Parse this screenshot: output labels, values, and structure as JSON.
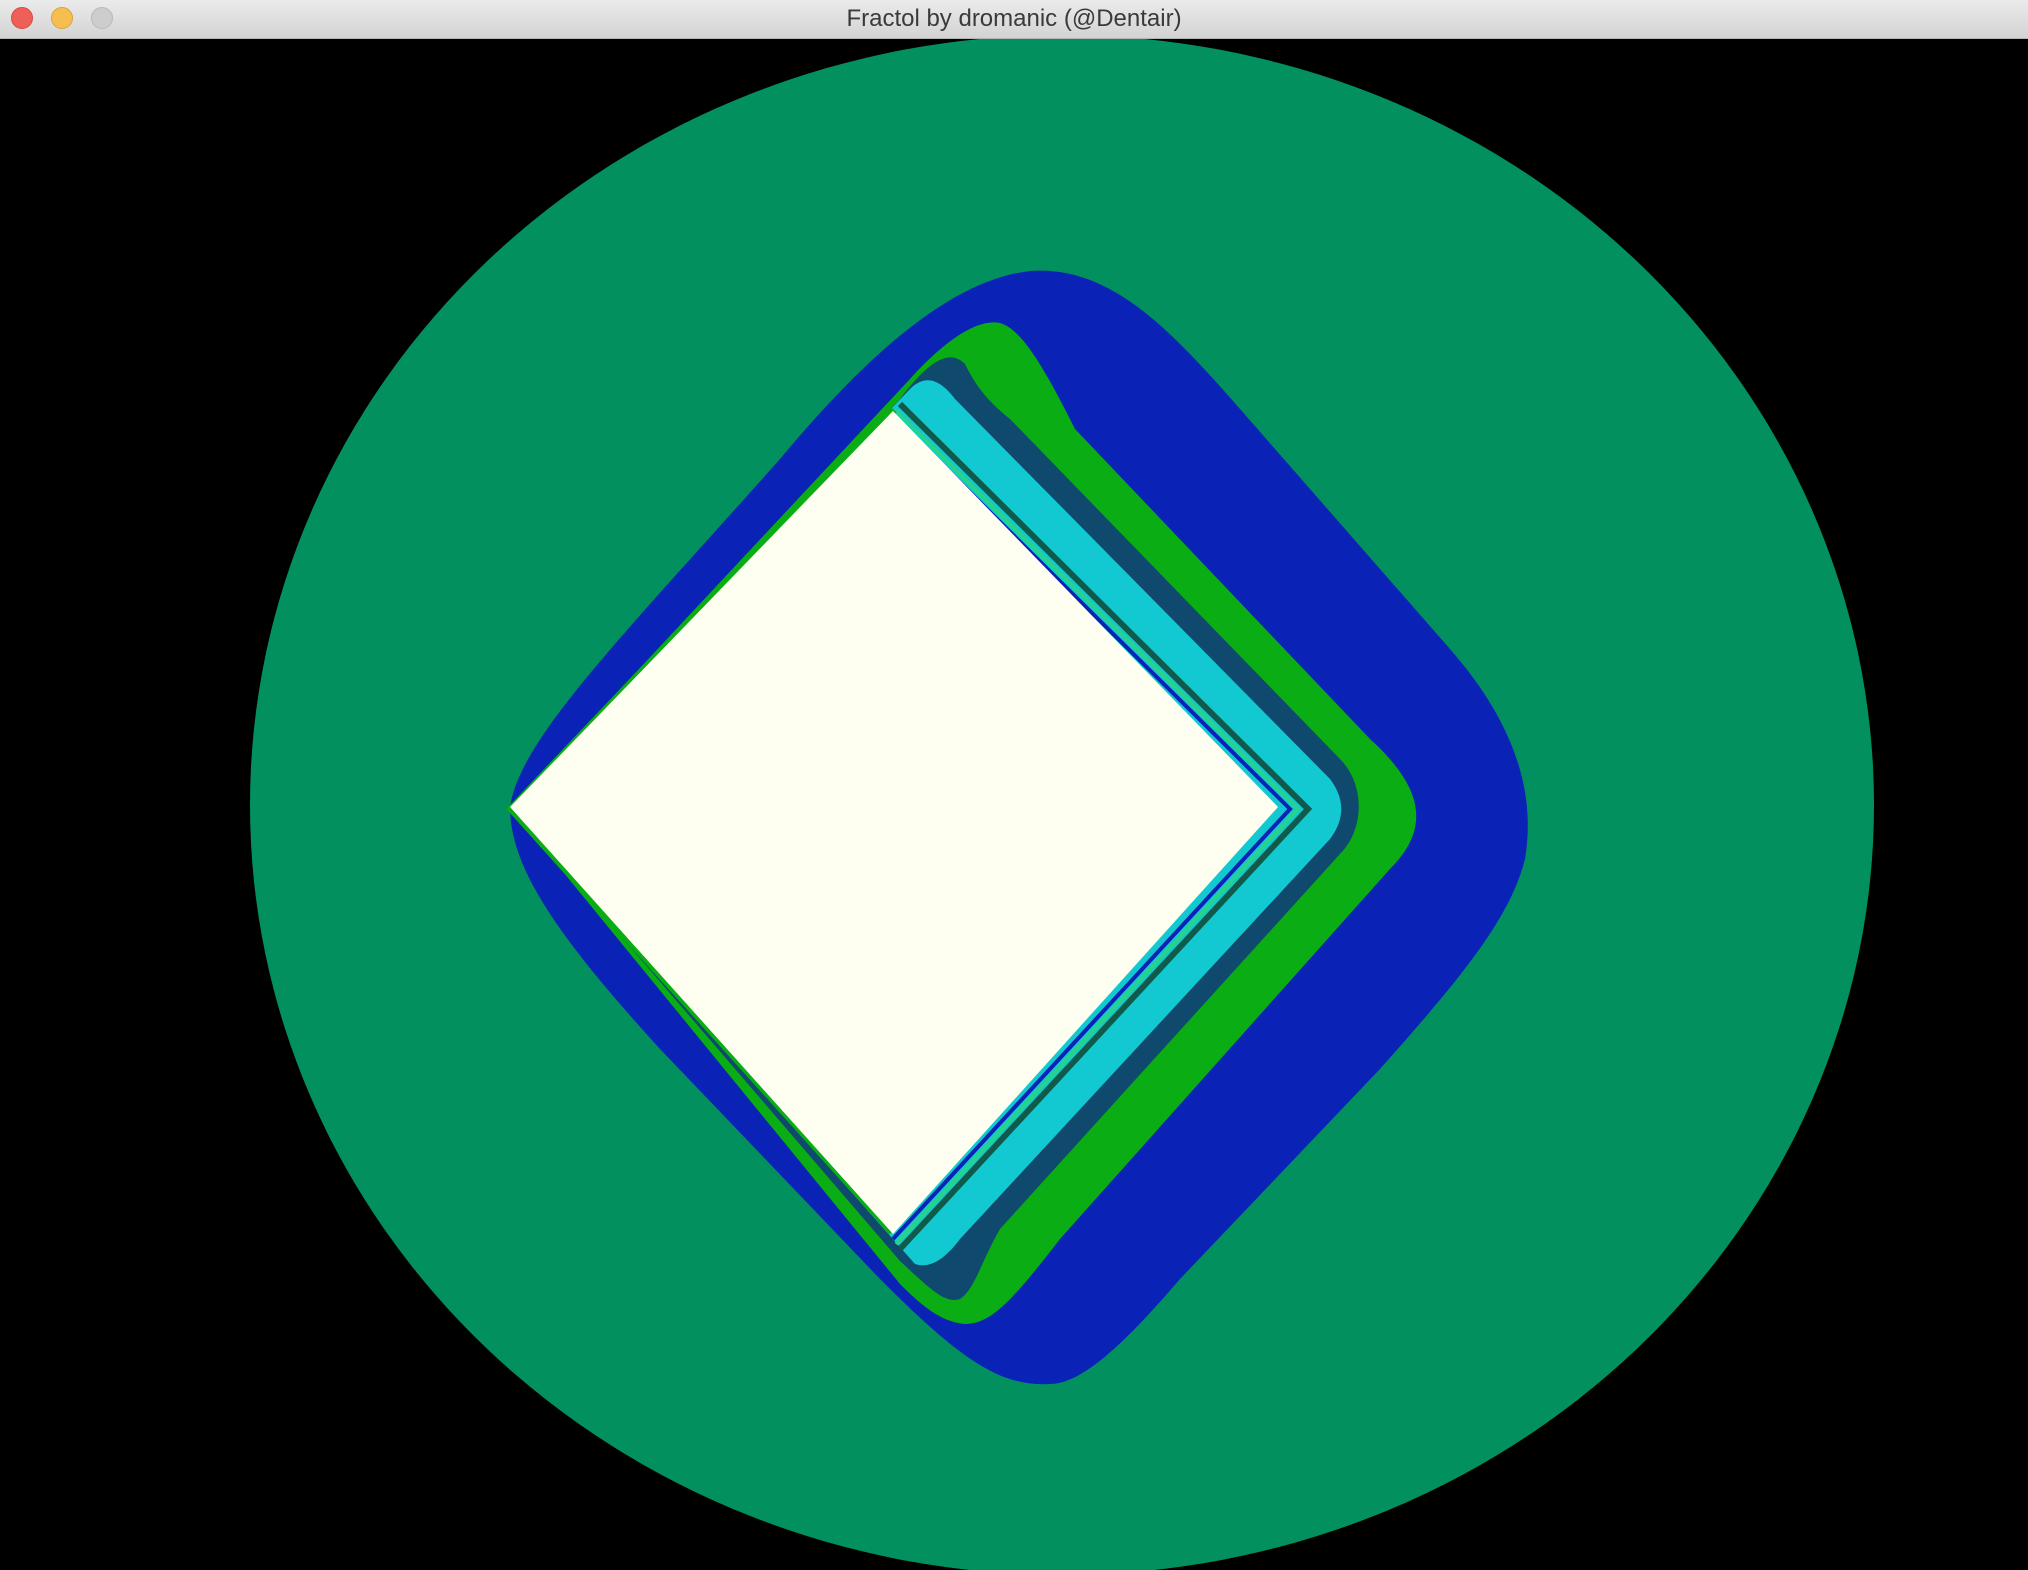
{
  "window": {
    "title": "Fractol by dromanic (@Dentair)"
  },
  "colors": {
    "background": "#000000",
    "outer_region": "#03905f",
    "blue_band": "#0b22b6",
    "green_band": "#0aad14",
    "navy_band": "#0f4a6e",
    "cyan_band": "#12c9d2",
    "interior": "#fefff0"
  },
  "icons": {
    "close": "close-circle-icon",
    "minimize": "minimize-circle-icon",
    "zoom": "zoom-circle-icon"
  }
}
